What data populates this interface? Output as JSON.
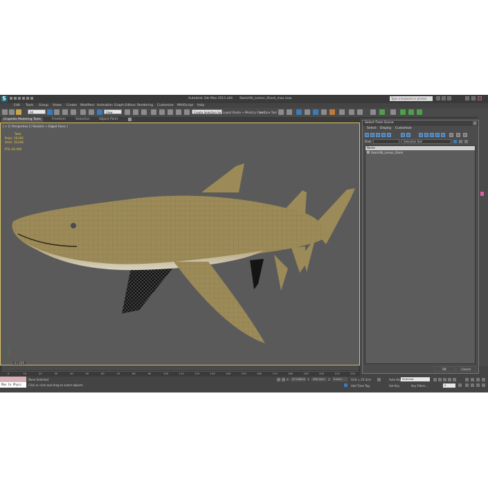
{
  "window": {
    "app_title": "Autodesk 3ds Max 2013 x64",
    "file_name": "Sketchfb_Lemon_Shark_max.max",
    "search_placeholder": "Type a keyword or phrase"
  },
  "menu": [
    "Edit",
    "Tools",
    "Group",
    "Views",
    "Create",
    "Modifiers",
    "Animation",
    "Graph Editors",
    "Rendering",
    "Customize",
    "MAXScript",
    "Help"
  ],
  "toolbar": {
    "selection_filter": "All",
    "ref_coord": "View",
    "named_selection": "Create Selection Se",
    "liquid_studio": "Liquid Studio + Ministry Check",
    "care_tool": "on Care Tool"
  },
  "ribbon_tabs": [
    "Graphite Modeling Tools",
    "Freeform",
    "Selection",
    "Object Paint"
  ],
  "viewport": {
    "label": "[ + ] [ Perspective ] [ Realistic + Edged Faces ]",
    "stats_header": "Total",
    "polys_label": "Polys:",
    "polys_value": "19,092",
    "verts_label": "Verts:",
    "verts_value": "16,928",
    "fps_label": "FPS:",
    "fps_value": "64.408",
    "frame_counter": "0 / 225"
  },
  "dialog": {
    "title": "Select From Scene",
    "close": "x",
    "menu": [
      "Select",
      "Display",
      "Customize"
    ],
    "find_label": "Find:",
    "selection_set": "Selection Set:",
    "column_name": "Name",
    "items": [
      "Sketchfb_Lemon_Shark"
    ],
    "ok": "OK",
    "cancel": "Cancel"
  },
  "timeline": {
    "ticks": [
      "0",
      "10",
      "20",
      "30",
      "40",
      "50",
      "60",
      "70",
      "80",
      "90",
      "100",
      "110",
      "120",
      "130",
      "140",
      "150",
      "160",
      "170",
      "180",
      "190",
      "200",
      "210",
      "220"
    ]
  },
  "status": {
    "maxscript": "Max to Physc",
    "none_selected": "None Selected",
    "prompt": "Click or click-and-drag to select objects",
    "x_label": "X:",
    "x_value": "47.208cm",
    "y_label": "Y:",
    "y_value": "284.4cm",
    "z_label": "Z:",
    "z_value": "0.0cm",
    "grid": "Grid = 25.4cm",
    "add_time_tag": "Add Time Tag",
    "auto_key": "Auto Key",
    "selected": "Selected",
    "set_key": "Set Key",
    "key_filters": "Key Filters...",
    "frame": "0"
  },
  "colors": {
    "accent_blue": "#3d7ab8",
    "viewport_border": "#d8c36a",
    "stats_text": "#e8c84a",
    "shark_body": "#9c8a58"
  }
}
